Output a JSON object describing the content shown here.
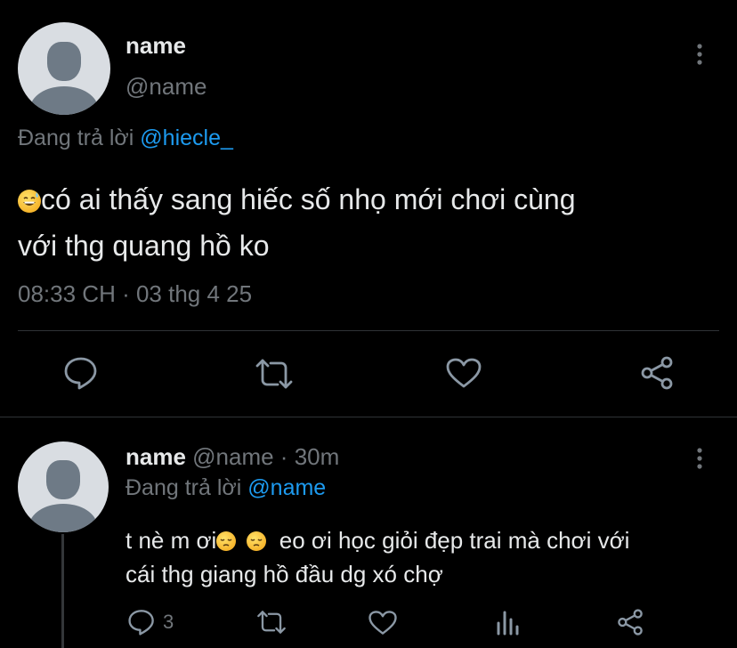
{
  "main_tweet": {
    "display_name": "name",
    "handle": "@name",
    "replying_prefix": "Đang trả lời",
    "replying_to": "@hiecle_",
    "text_line1": "có ai thấy sang hiếc số nhọ mới chơi cùng",
    "text_line2": "với thg quang hồ ko",
    "leading_emoji": "grinning-sweat-emoji",
    "timestamp": "08:33 CH · 03 thg 4 25"
  },
  "reply_tweet": {
    "display_name": "name",
    "handle_time": "@name · 30m",
    "replying_prefix": "Đang trả lời",
    "replying_to": "@name",
    "text_part1": "t nè m ơi",
    "text_part2": "eo ơi học giỏi đẹp trai mà chơi với",
    "text_line2": "cái thg giang hồ đầu dg xó chợ",
    "emojis": [
      "pensive-emoji",
      "pensive-emoji"
    ],
    "reply_count": "3"
  },
  "icons": {
    "more": "more-vertical-icon",
    "reply": "reply-icon",
    "retweet": "retweet-icon",
    "like": "like-icon",
    "share": "share-icon",
    "views": "views-icon"
  },
  "colors": {
    "background": "#000000",
    "text": "#e7e9ea",
    "muted": "#71767b",
    "accent": "#1d9bf0",
    "divider": "#2f3336"
  }
}
